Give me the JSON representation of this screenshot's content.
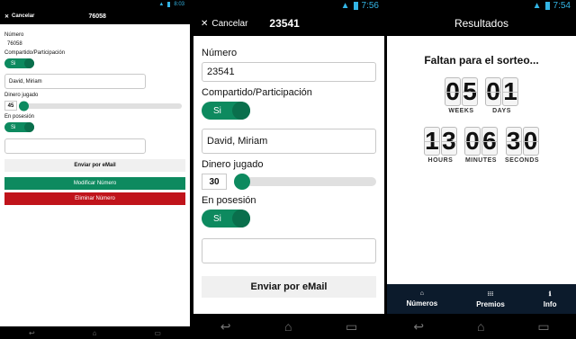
{
  "panel1": {
    "status": {
      "time": "8:03"
    },
    "appbar": {
      "cancel_label": "Cancelar",
      "title": "76058"
    },
    "numero_label": "Número",
    "numero_value": "76058",
    "compartido_label": "Compartido/Participación",
    "compartido_toggle": "Si",
    "name_value": "David, Miriam",
    "dinero_label": "Dinero jugado",
    "dinero_value": "45",
    "dinero_level": 0.02,
    "posesion_label": "En posesión",
    "posesion_toggle": "Si",
    "note_value": "",
    "email_button": "Enviar por eMail",
    "modify_button": "Modificar Número",
    "delete_button": "Eliminar Número",
    "colors": {
      "modify": "#0d8a5f",
      "delete": "#c0141b"
    }
  },
  "panel2": {
    "status": {
      "time": "7:56"
    },
    "appbar": {
      "cancel_label": "Cancelar",
      "title": "23541"
    },
    "numero_label": "Número",
    "numero_value": "23541",
    "compartido_label": "Compartido/Participación",
    "compartido_toggle": "Si",
    "name_value": "David, Miriam",
    "dinero_label": "Dinero jugado",
    "dinero_value": "30",
    "dinero_level": 0.02,
    "posesion_label": "En posesión",
    "posesion_toggle": "Si",
    "note_value": "",
    "email_button": "Enviar por eMail"
  },
  "panel3": {
    "status": {
      "time": "7:54"
    },
    "appbar": {
      "title": "Resultados"
    },
    "countdown_title": "Faltan para el sorteo...",
    "weeks": {
      "value": "05",
      "caption": "WEEKS"
    },
    "days": {
      "value": "01",
      "caption": "DAYS"
    },
    "hours": {
      "value": "13",
      "caption": "HOURS"
    },
    "minutes": {
      "value": "06",
      "caption": "MINUTES"
    },
    "seconds": {
      "value": "30",
      "caption": "SECONDS"
    },
    "tabs": [
      {
        "label": "Números",
        "icon": "home-icon"
      },
      {
        "label": "Premios",
        "icon": "grid-icon"
      },
      {
        "label": "Info",
        "icon": "info-icon"
      }
    ]
  },
  "accent": "#0d8a5f",
  "status_color": "#33b5e5"
}
